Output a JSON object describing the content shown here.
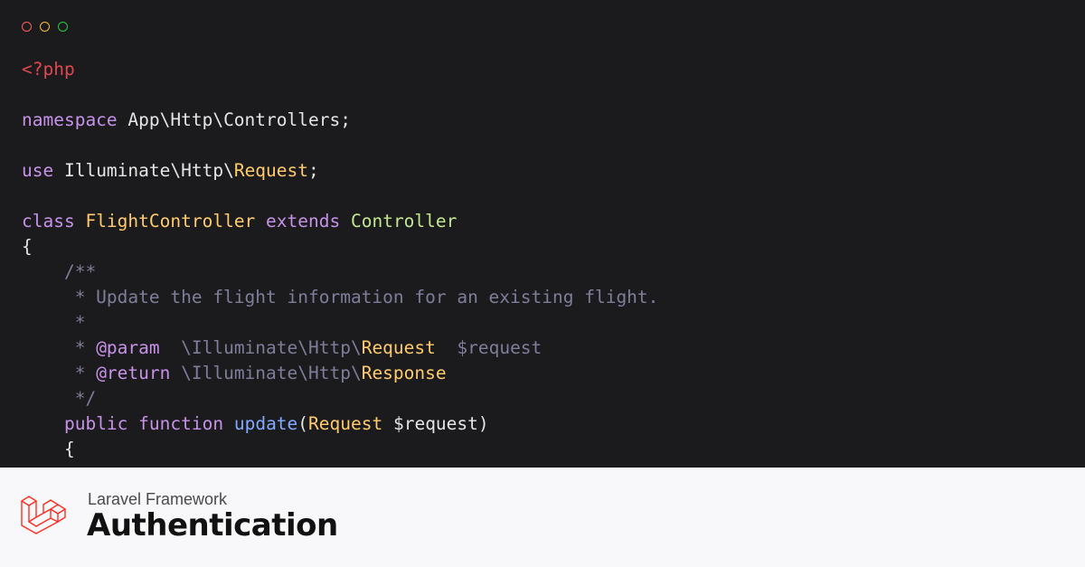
{
  "window": {
    "controls": [
      {
        "name": "close",
        "color": "#ff5f57"
      },
      {
        "name": "minimize",
        "color": "#febc2e"
      },
      {
        "name": "maximize",
        "color": "#28c840"
      }
    ]
  },
  "colors": {
    "background": "#1b1b1d",
    "footer_bg": "#f8f8fa",
    "tag": "#e0484e",
    "keyword": "#c792ea",
    "plain": "#e5e5e5",
    "class_name": "#ffcb6b",
    "parent_class": "#c3e88d",
    "comment": "#7e7e9a",
    "function_name": "#82aaff",
    "brand_red": "#ff2d20"
  },
  "code": [
    [
      {
        "t": "<?php",
        "c": "tag"
      }
    ],
    [],
    [
      {
        "t": "namespace",
        "c": "keyword"
      },
      {
        "t": " App\\Http\\Controllers;",
        "c": "plain"
      }
    ],
    [],
    [
      {
        "t": "use",
        "c": "keyword"
      },
      {
        "t": " Illuminate\\Http\\",
        "c": "plain"
      },
      {
        "t": "Request",
        "c": "class_name"
      },
      {
        "t": ";",
        "c": "plain"
      }
    ],
    [],
    [
      {
        "t": "class",
        "c": "keyword"
      },
      {
        "t": " ",
        "c": "plain"
      },
      {
        "t": "FlightController",
        "c": "class_name"
      },
      {
        "t": " ",
        "c": "plain"
      },
      {
        "t": "extends",
        "c": "keyword"
      },
      {
        "t": " ",
        "c": "plain"
      },
      {
        "t": "Controller",
        "c": "parent_class"
      }
    ],
    [
      {
        "t": "{",
        "c": "plain"
      }
    ],
    [
      {
        "t": "    /**",
        "c": "comment"
      }
    ],
    [
      {
        "t": "     * Update the flight information for an existing flight.",
        "c": "comment"
      }
    ],
    [
      {
        "t": "     *",
        "c": "comment"
      }
    ],
    [
      {
        "t": "     * ",
        "c": "comment"
      },
      {
        "t": "@param",
        "c": "keyword"
      },
      {
        "t": "  \\Illuminate\\Http\\",
        "c": "comment"
      },
      {
        "t": "Request",
        "c": "class_name"
      },
      {
        "t": "  $request",
        "c": "comment"
      }
    ],
    [
      {
        "t": "     * ",
        "c": "comment"
      },
      {
        "t": "@return",
        "c": "keyword"
      },
      {
        "t": " \\Illuminate\\Http\\",
        "c": "comment"
      },
      {
        "t": "Response",
        "c": "class_name"
      }
    ],
    [
      {
        "t": "     */",
        "c": "comment"
      }
    ],
    [
      {
        "t": "    ",
        "c": "plain"
      },
      {
        "t": "public",
        "c": "keyword"
      },
      {
        "t": " ",
        "c": "plain"
      },
      {
        "t": "function",
        "c": "keyword"
      },
      {
        "t": " ",
        "c": "plain"
      },
      {
        "t": "update",
        "c": "function_name"
      },
      {
        "t": "(",
        "c": "plain"
      },
      {
        "t": "Request",
        "c": "class_name"
      },
      {
        "t": " $request)",
        "c": "plain"
      }
    ],
    [
      {
        "t": "    {",
        "c": "plain"
      }
    ]
  ],
  "footer": {
    "logo_icon": "laravel-logo-icon",
    "framework_label": "Laravel Framework",
    "title": "Authentication"
  }
}
